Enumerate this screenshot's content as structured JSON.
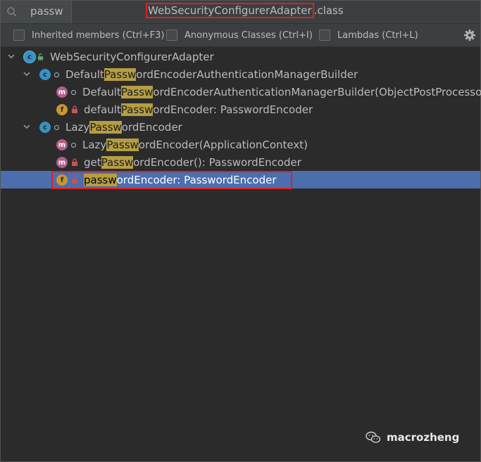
{
  "header": {
    "search_text": "passw",
    "title_main": "WebSecurityConfigurerAdapter",
    "title_suffix": ".class"
  },
  "options": {
    "inherited": "Inherited members (Ctrl+F3)",
    "anonymous": "Anonymous Classes (Ctrl+I)",
    "lambdas": "Lambdas (Ctrl+L)"
  },
  "tree": {
    "root": "WebSecurityConfigurerAdapter",
    "r1": {
      "pre": "Default",
      "hl": "Passw",
      "post": "ordEncoderAuthenticationManagerBuilder"
    },
    "r2": {
      "pre": "Default",
      "hl": "Passw",
      "post": "ordEncoderAuthenticationManagerBuilder(ObjectPostProcessor"
    },
    "r3": {
      "pre": "default",
      "hl": "Passw",
      "post": "ordEncoder: PasswordEncoder"
    },
    "r4": {
      "pre": "Lazy",
      "hl": "Passw",
      "post": "ordEncoder"
    },
    "r5": {
      "pre": "Lazy",
      "hl": "Passw",
      "post": "ordEncoder(ApplicationContext)"
    },
    "r6": {
      "pre": "get",
      "hl": "Passw",
      "post": "ordEncoder(): PasswordEncoder"
    },
    "r7": {
      "pre": "",
      "hl": "passw",
      "post": "ordEncoder: PasswordEncoder"
    }
  },
  "icons": {
    "class_letter": "c",
    "method_letter": "m",
    "field_letter": "f",
    "root_letter": "c"
  },
  "watermark": {
    "text": "macrozheng"
  }
}
